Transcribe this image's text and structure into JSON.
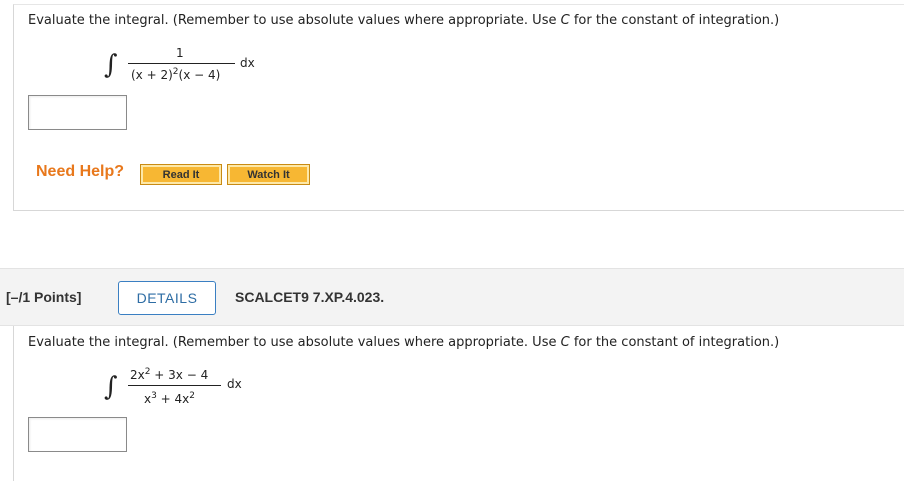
{
  "question1": {
    "prompt_before_c": "Evaluate the integral. (Remember to use absolute values where appropriate. Use ",
    "prompt_c": "C",
    "prompt_after_c": " for the constant of integration.)",
    "integral_sign": "∫",
    "numerator": "1",
    "denominator_base": "(x + 2)",
    "denominator_exp": "2",
    "denominator_tail": "(x − 4)",
    "differential": "dx",
    "answer_value": ""
  },
  "help": {
    "label": "Need Help?",
    "read_it": "Read It",
    "watch_it": "Watch It"
  },
  "question2_header": {
    "points": "[–/1 Points]",
    "details_label": "DETAILS",
    "code": "SCALCET9 7.XP.4.023."
  },
  "question2": {
    "prompt_before_c": "Evaluate the integral. (Remember to use absolute values where appropriate. Use ",
    "prompt_c": "C",
    "prompt_after_c": " for the constant of integration.)",
    "integral_sign": "∫",
    "num_a": "2x",
    "num_a_exp": "2",
    "num_b": " + 3x − 4",
    "den_a": "x",
    "den_a_exp": "3",
    "den_b": " + 4x",
    "den_b_exp": "2",
    "differential": "dx",
    "answer_value": ""
  }
}
